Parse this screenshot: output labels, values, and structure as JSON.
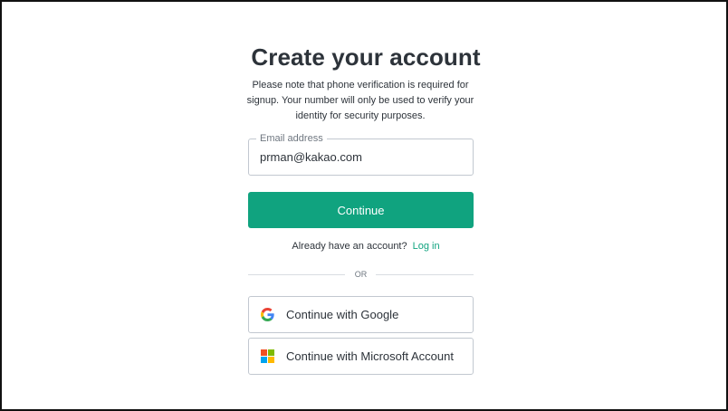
{
  "page": {
    "title": "Create your account",
    "subtitle": "Please note that phone verification is required for signup. Your number will only be used to verify your identity for security purposes."
  },
  "email": {
    "label": "Email address",
    "value": "prman@kakao.com"
  },
  "continue_button": {
    "label": "Continue",
    "color": "#10a37f"
  },
  "login": {
    "prompt": "Already have an account?",
    "link": "Log in"
  },
  "divider": {
    "text": "OR"
  },
  "social": {
    "google": {
      "label": "Continue with Google",
      "icon": "google-icon"
    },
    "microsoft": {
      "label": "Continue with Microsoft Account",
      "icon": "microsoft-icon",
      "colors": [
        "#f25022",
        "#7fba00",
        "#00a4ef",
        "#ffb900"
      ]
    }
  }
}
